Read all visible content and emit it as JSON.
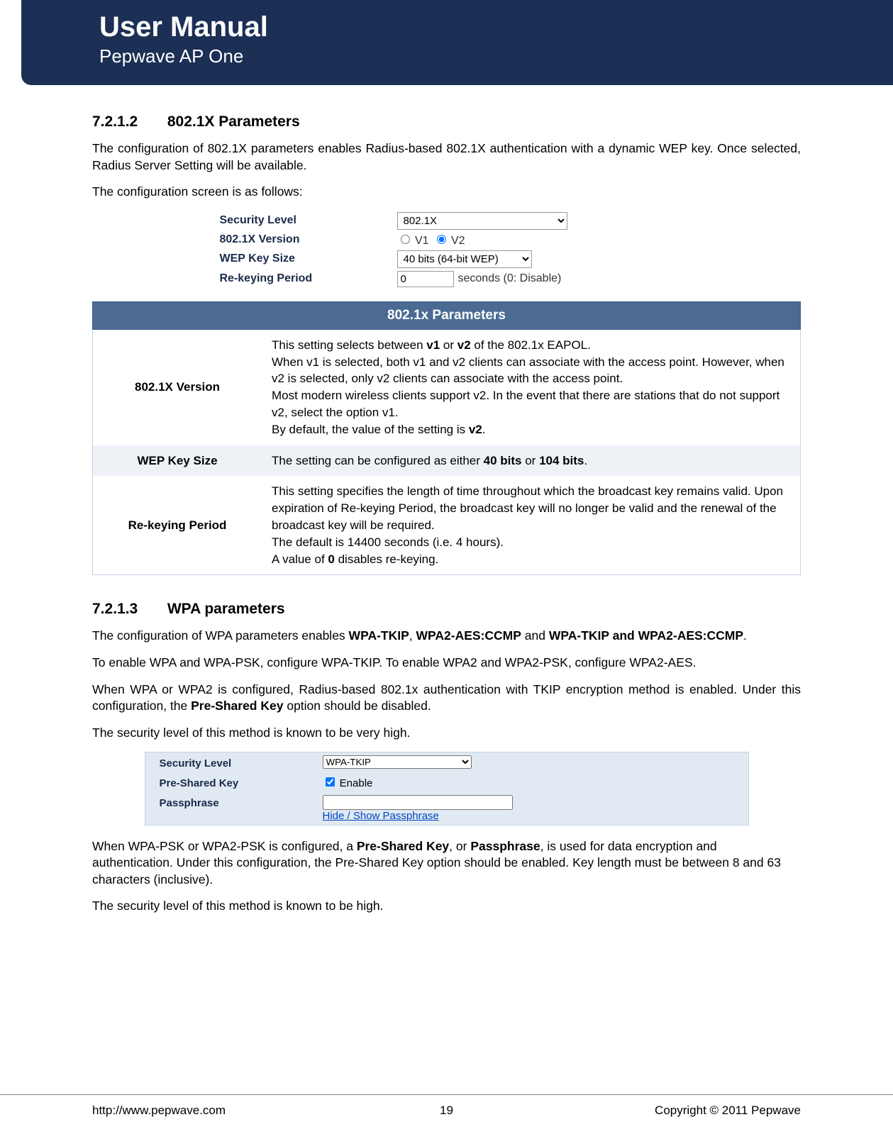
{
  "header": {
    "title": "User Manual",
    "subtitle": "Pepwave AP One"
  },
  "sections": {
    "s1": {
      "num": "7.2.1.2",
      "title": "802.1X Parameters"
    },
    "s2": {
      "num": "7.2.1.3",
      "title": "WPA parameters"
    }
  },
  "body": {
    "p1a": "The configuration of 802.1X parameters enables Radius-based 802.1X authentication with a dynamic WEP key.  Once selected, Radius Server Setting will be available.",
    "p1b": "The configuration screen is as follows:",
    "p2a_pre": "The configuration of WPA parameters enables ",
    "p2a_b1": "WPA-TKIP",
    "p2a_mid1": ", ",
    "p2a_b2": "WPA2-AES:CCMP",
    "p2a_mid2": " and ",
    "p2a_b3": "WPA-TKIP and WPA2-AES:CCMP",
    "p2a_post": ".",
    "p2b": "To enable WPA and WPA-PSK, configure WPA-TKIP. To enable WPA2 and WPA2-PSK, configure WPA2-AES.",
    "p2c_pre": "When WPA or WPA2 is configured, Radius-based 802.1x authentication with TKIP encryption method is enabled. Under this configuration, the ",
    "p2c_b": "Pre-Shared Key",
    "p2c_post": " option should be disabled.",
    "p2d": "The security level of this method is known to be very high.",
    "p2e_pre": "When WPA-PSK or WPA2-PSK is configured, a ",
    "p2e_b1": "Pre-Shared Key",
    "p2e_mid": ", or ",
    "p2e_b2": "Passphrase",
    "p2e_post": ", is used for data encryption and authentication.  Under this configuration, the Pre-Shared Key option should be enabled.  Key length must be between 8 and 63 characters (inclusive).",
    "p2f": "The security level of this method is known to be high."
  },
  "config1": {
    "rows": {
      "sec_level": {
        "label": "Security Level",
        "value": "802.1X"
      },
      "version": {
        "label": "802.1X Version",
        "opt1": "V1",
        "opt2": "V2"
      },
      "keysize": {
        "label": "WEP Key Size",
        "value": "40 bits (64-bit WEP)"
      },
      "rekey": {
        "label": "Re-keying Period",
        "value": "0",
        "suffix": "seconds (0: Disable)"
      }
    }
  },
  "paramtable": {
    "title": "802.1x Parameters",
    "rows": [
      {
        "label": "802.1X Version",
        "desc_parts": {
          "l1a": "This setting selects between ",
          "l1b1": "v1",
          "l1mid": " or ",
          "l1b2": "v2",
          "l1c": " of the 802.1x EAPOL.",
          "l2": "When v1 is selected, both v1 and v2 clients can associate with the access point.  However, when v2 is selected, only v2 clients can associate with the access point.",
          "l3": "Most modern wireless clients support v2.  In the event that there are stations that do not support v2, select the option v1.",
          "l4a": "By default, the value of the setting is ",
          "l4b": "v2",
          "l4c": "."
        }
      },
      {
        "label": "WEP Key Size",
        "desc_parts": {
          "l1a": "The setting can be configured as either ",
          "l1b1": "40 bits",
          "l1mid": " or ",
          "l1b2": "104 bits",
          "l1c": "."
        }
      },
      {
        "label": "Re-keying Period",
        "desc_parts": {
          "l1": "This setting specifies the length of time throughout which the broadcast key remains valid. Upon expiration of Re-keying Period, the broadcast key will no longer be valid and the renewal of the broadcast key will be required.",
          "l2": "The default is 14400 seconds (i.e. 4 hours).",
          "l3a": "A value of ",
          "l3b": "0",
          "l3c": " disables re-keying."
        }
      }
    ]
  },
  "wpa_box": {
    "rows": {
      "sec_level": {
        "label": "Security Level",
        "value": "WPA-TKIP"
      },
      "psk": {
        "label": "Pre-Shared Key",
        "chk": "Enable"
      },
      "pass": {
        "label": "Passphrase",
        "link": "Hide / Show Passphrase"
      }
    }
  },
  "footer": {
    "url": "http://www.pepwave.com",
    "page": "19",
    "copy": "Copyright © 2011 Pepwave"
  }
}
